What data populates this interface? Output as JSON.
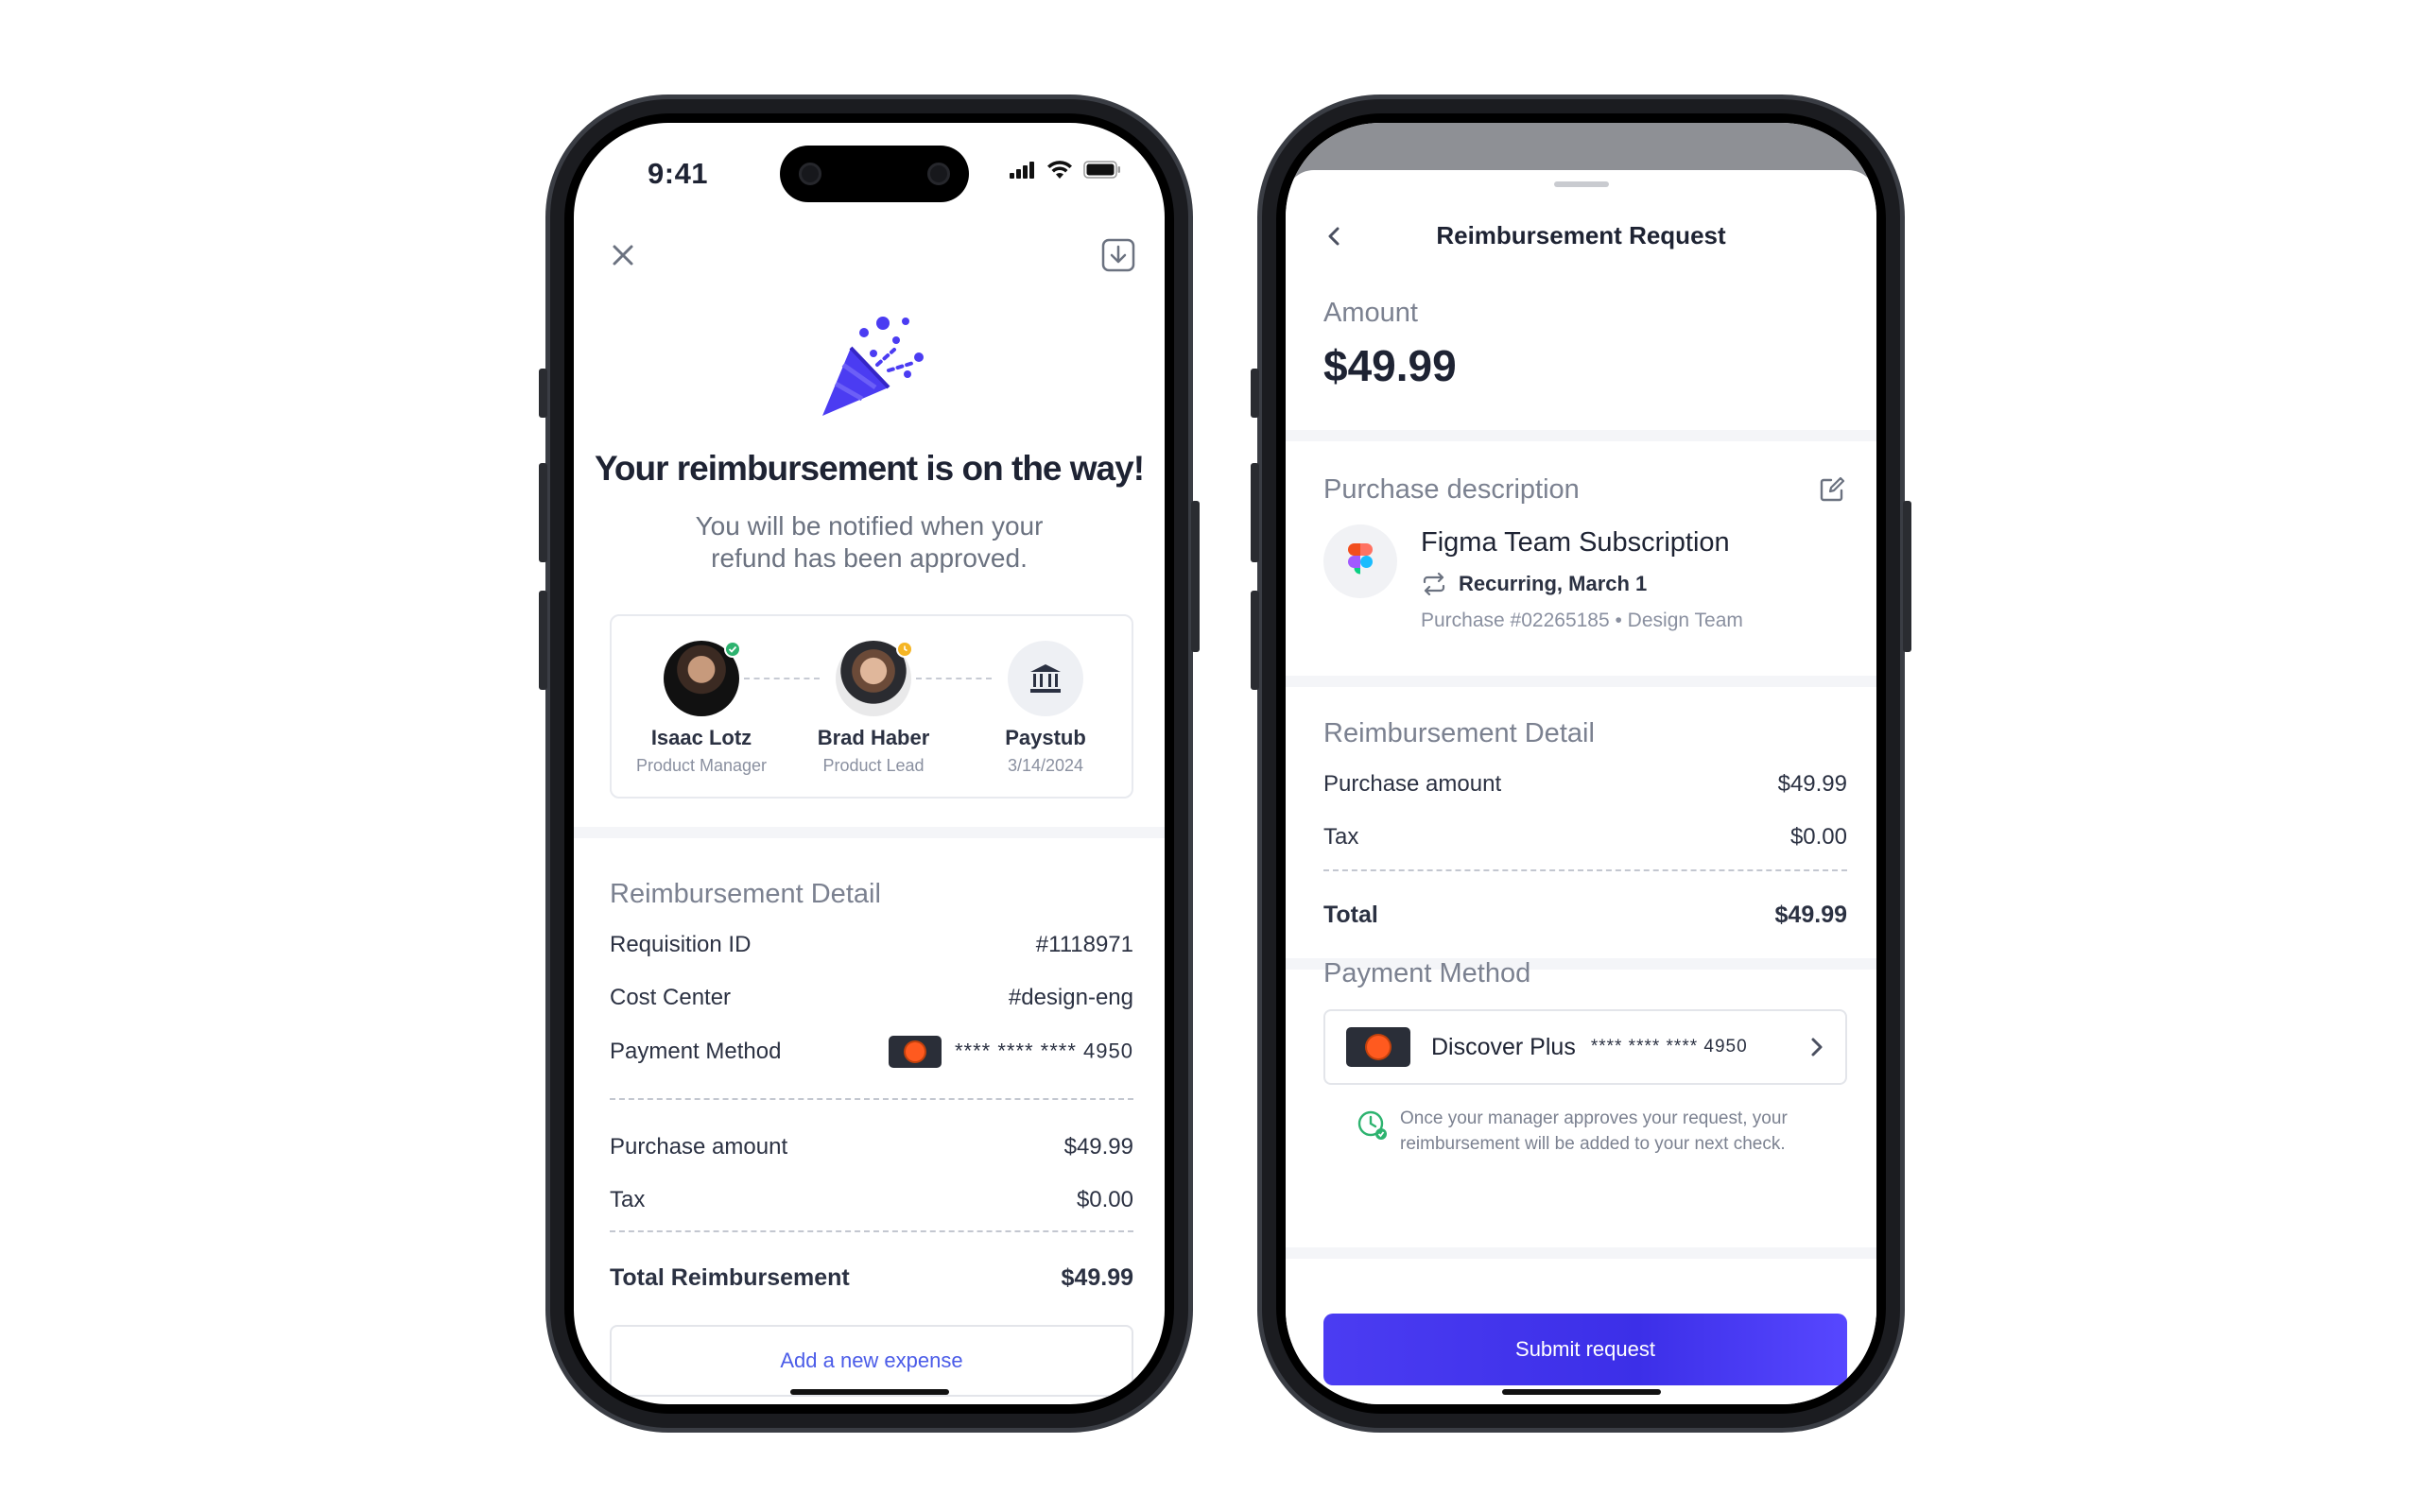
{
  "colors": {
    "accent": "#4b3cf2",
    "link": "#4b5ce8",
    "heading_muted": "#7b8190",
    "text": "#1e2333",
    "card_chip": "#2a2e38",
    "card_dot": "#ff5a1f"
  },
  "confirmation_screen": {
    "status_time": "9:41",
    "close_icon": "close-icon",
    "download_icon": "download-icon",
    "celebration_icon": "party-popper-icon",
    "title": "Your reimbursement is on the way!",
    "subtitle": "You will be notified when your refund has been approved.",
    "approvers": [
      {
        "name": "Isaac Lotz",
        "role": "Product Manager",
        "status": "approved"
      },
      {
        "name": "Brad Haber",
        "role": "Product Lead",
        "status": "pending"
      },
      {
        "name": "Paystub",
        "role": "3/14/2024",
        "icon": "bank-icon"
      }
    ],
    "detail": {
      "heading": "Reimbursement Detail",
      "requisition_label": "Requisition ID",
      "requisition_value": "#1118971",
      "cost_center_label": "Cost Center",
      "cost_center_value": "#design-eng",
      "payment_method_label": "Payment Method",
      "payment_method_value": "**** **** **** 4950",
      "purchase_amount_label": "Purchase amount",
      "purchase_amount_value": "$49.99",
      "tax_label": "Tax",
      "tax_value": "$0.00",
      "total_label": "Total Reimbursement",
      "total_value": "$49.99"
    },
    "add_expense_label": "Add a new expense"
  },
  "request_screen": {
    "back_icon": "chevron-left-icon",
    "title": "Reimbursement Request",
    "amount_label": "Amount",
    "amount_value": "$49.99",
    "purchase": {
      "heading": "Purchase description",
      "edit_icon": "edit-icon",
      "merchant_icon": "figma-logo-icon",
      "merchant_name": "Figma Team Subscription",
      "recurring_text": "Recurring, March 1",
      "meta": "Purchase #02265185 • Design Team"
    },
    "detail": {
      "heading": "Reimbursement Detail",
      "purchase_amount_label": "Purchase amount",
      "purchase_amount_value": "$49.99",
      "tax_label": "Tax",
      "tax_value": "$0.00",
      "total_label": "Total",
      "total_value": "$49.99"
    },
    "payment": {
      "heading": "Payment Method",
      "card_name": "Discover Plus",
      "card_masked": "**** **** **** 4950",
      "note": "Once your manager approves your request, your reimbursement will be added to your next check."
    },
    "submit_label": "Submit request"
  }
}
